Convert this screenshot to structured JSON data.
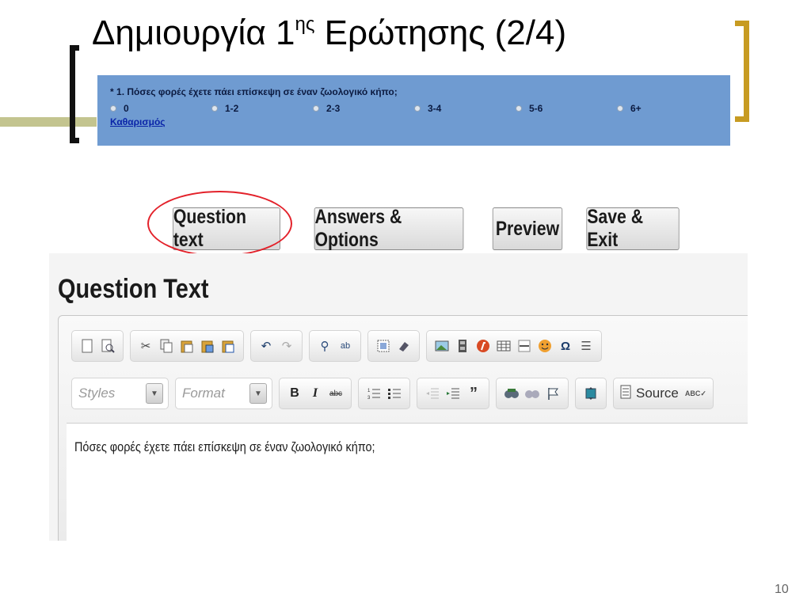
{
  "slide": {
    "title_main": "Δημιουργία 1",
    "title_sup": "ης",
    "title_rest": " Ερώτησης (2/4)",
    "page_number": "10",
    "colors": {
      "accent_gold": "#c79b22",
      "olive": "#c3c48f",
      "survey_blue": "#6f9bd1",
      "highlight_red": "#e3212a"
    }
  },
  "survey": {
    "required_mark": "* ",
    "question": "1. Πόσες φορές έχετε πάει επίσκεψη σε έναν ζωολογικό κήπο;",
    "options": [
      "0",
      "1-2",
      "2-3",
      "3-4",
      "5-6",
      "6+"
    ],
    "clear_link": "Καθαρισμός"
  },
  "tabs": {
    "question_text": "Question text",
    "answers_options": "Answers & Options",
    "preview": "Preview",
    "save_exit": "Save & Exit"
  },
  "editor": {
    "heading": "Question Text",
    "styles_label": "Styles",
    "format_label": "Format",
    "bold_label": "B",
    "italic_label": "I",
    "strike_label": "abc",
    "source_label": "Source",
    "content": "Πόσες φορές έχετε πάει επίσκεψη σε έναν ζωολογικό κήπο;"
  }
}
